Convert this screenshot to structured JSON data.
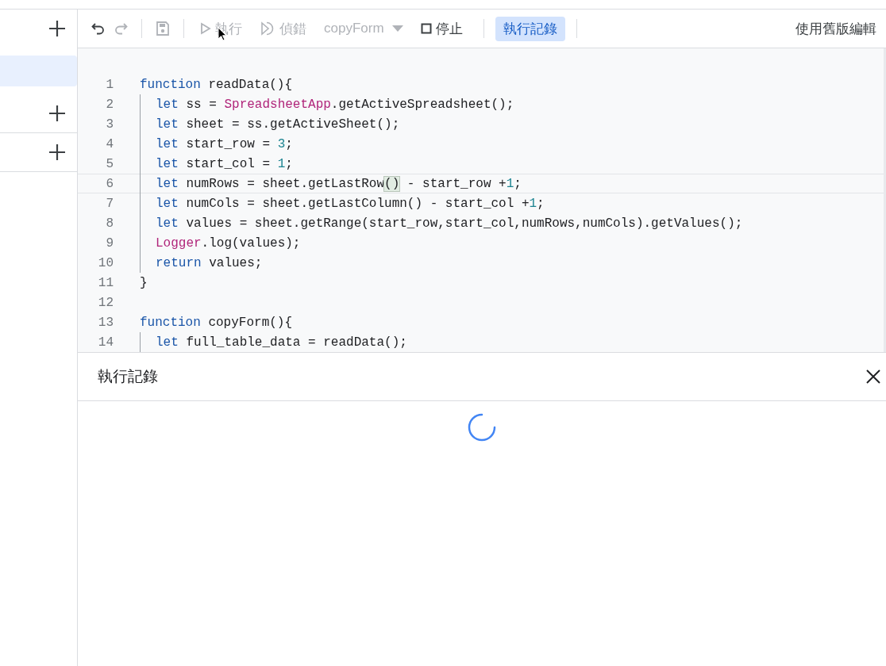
{
  "sidebar": {
    "rows": [
      {
        "kind": "add"
      },
      {
        "kind": "item",
        "selected": true
      },
      {
        "kind": "add"
      },
      {
        "kind": "add"
      }
    ]
  },
  "toolbar": {
    "undo": {
      "disabled": false
    },
    "redo": {
      "disabled": true
    },
    "save": {
      "disabled": true
    },
    "run": {
      "label": "執行",
      "disabled": true
    },
    "debug": {
      "label": "偵錯",
      "disabled": true
    },
    "function_select": {
      "value": "copyForm",
      "disabled": true
    },
    "stop": {
      "label": "停止",
      "disabled": false
    },
    "log_toggle": {
      "label": "執行記錄",
      "selected": true
    },
    "legacy_editor": {
      "label": "使用舊版編輯"
    }
  },
  "editor": {
    "lines": [
      {
        "number": "1",
        "indented": false,
        "current": false,
        "tokens": [
          {
            "kind": "kw",
            "text": "function"
          },
          {
            "kind": "plain",
            "text": " readData(){"
          }
        ]
      },
      {
        "number": "2",
        "indented": true,
        "current": false,
        "tokens": [
          {
            "kind": "kw",
            "text": "let"
          },
          {
            "kind": "plain",
            "text": " ss = "
          },
          {
            "kind": "class",
            "text": "SpreadsheetApp"
          },
          {
            "kind": "plain",
            "text": ".getActiveSpreadsheet();"
          }
        ]
      },
      {
        "number": "3",
        "indented": true,
        "current": false,
        "tokens": [
          {
            "kind": "kw",
            "text": "let"
          },
          {
            "kind": "plain",
            "text": " sheet = ss.getActiveSheet();"
          }
        ]
      },
      {
        "number": "4",
        "indented": true,
        "current": false,
        "tokens": [
          {
            "kind": "kw",
            "text": "let"
          },
          {
            "kind": "plain",
            "text": " start_row = "
          },
          {
            "kind": "num",
            "text": "3"
          },
          {
            "kind": "plain",
            "text": ";"
          }
        ]
      },
      {
        "number": "5",
        "indented": true,
        "current": false,
        "tokens": [
          {
            "kind": "kw",
            "text": "let"
          },
          {
            "kind": "plain",
            "text": " start_col = "
          },
          {
            "kind": "num",
            "text": "1"
          },
          {
            "kind": "plain",
            "text": ";"
          }
        ]
      },
      {
        "number": "6",
        "indented": true,
        "current": true,
        "tokens": [
          {
            "kind": "kw",
            "text": "let"
          },
          {
            "kind": "plain",
            "text": " numRows = sheet.getLastRow"
          },
          {
            "kind": "bracket",
            "text": "()"
          },
          {
            "kind": "plain",
            "text": " - start_row +"
          },
          {
            "kind": "num",
            "text": "1"
          },
          {
            "kind": "plain",
            "text": ";"
          }
        ]
      },
      {
        "number": "7",
        "indented": true,
        "current": false,
        "tokens": [
          {
            "kind": "kw",
            "text": "let"
          },
          {
            "kind": "plain",
            "text": " numCols = sheet.getLastColumn() - start_col +"
          },
          {
            "kind": "num",
            "text": "1"
          },
          {
            "kind": "plain",
            "text": ";"
          }
        ]
      },
      {
        "number": "8",
        "indented": true,
        "current": false,
        "tokens": [
          {
            "kind": "kw",
            "text": "let"
          },
          {
            "kind": "plain",
            "text": " values = sheet.getRange(start_row,start_col,numRows,numCols).getValues();"
          }
        ]
      },
      {
        "number": "9",
        "indented": true,
        "current": false,
        "tokens": [
          {
            "kind": "class",
            "text": "Logger"
          },
          {
            "kind": "plain",
            "text": ".log(values);"
          }
        ]
      },
      {
        "number": "10",
        "indented": true,
        "current": false,
        "tokens": [
          {
            "kind": "kw",
            "text": "return"
          },
          {
            "kind": "plain",
            "text": " values;"
          }
        ]
      },
      {
        "number": "11",
        "indented": false,
        "current": false,
        "tokens": [
          {
            "kind": "plain",
            "text": "}"
          }
        ]
      },
      {
        "number": "12",
        "indented": false,
        "current": false
      },
      {
        "number": "13",
        "indented": false,
        "current": false,
        "tokens": [
          {
            "kind": "kw",
            "text": "function"
          },
          {
            "kind": "plain",
            "text": " copyForm(){"
          }
        ]
      },
      {
        "number": "14",
        "indented": true,
        "current": false,
        "tokens": [
          {
            "kind": "kw",
            "text": "let"
          },
          {
            "kind": "plain",
            "text": " full_table_data = readData();"
          }
        ]
      }
    ]
  },
  "log_panel": {
    "title": "執行記錄",
    "loading": true
  }
}
